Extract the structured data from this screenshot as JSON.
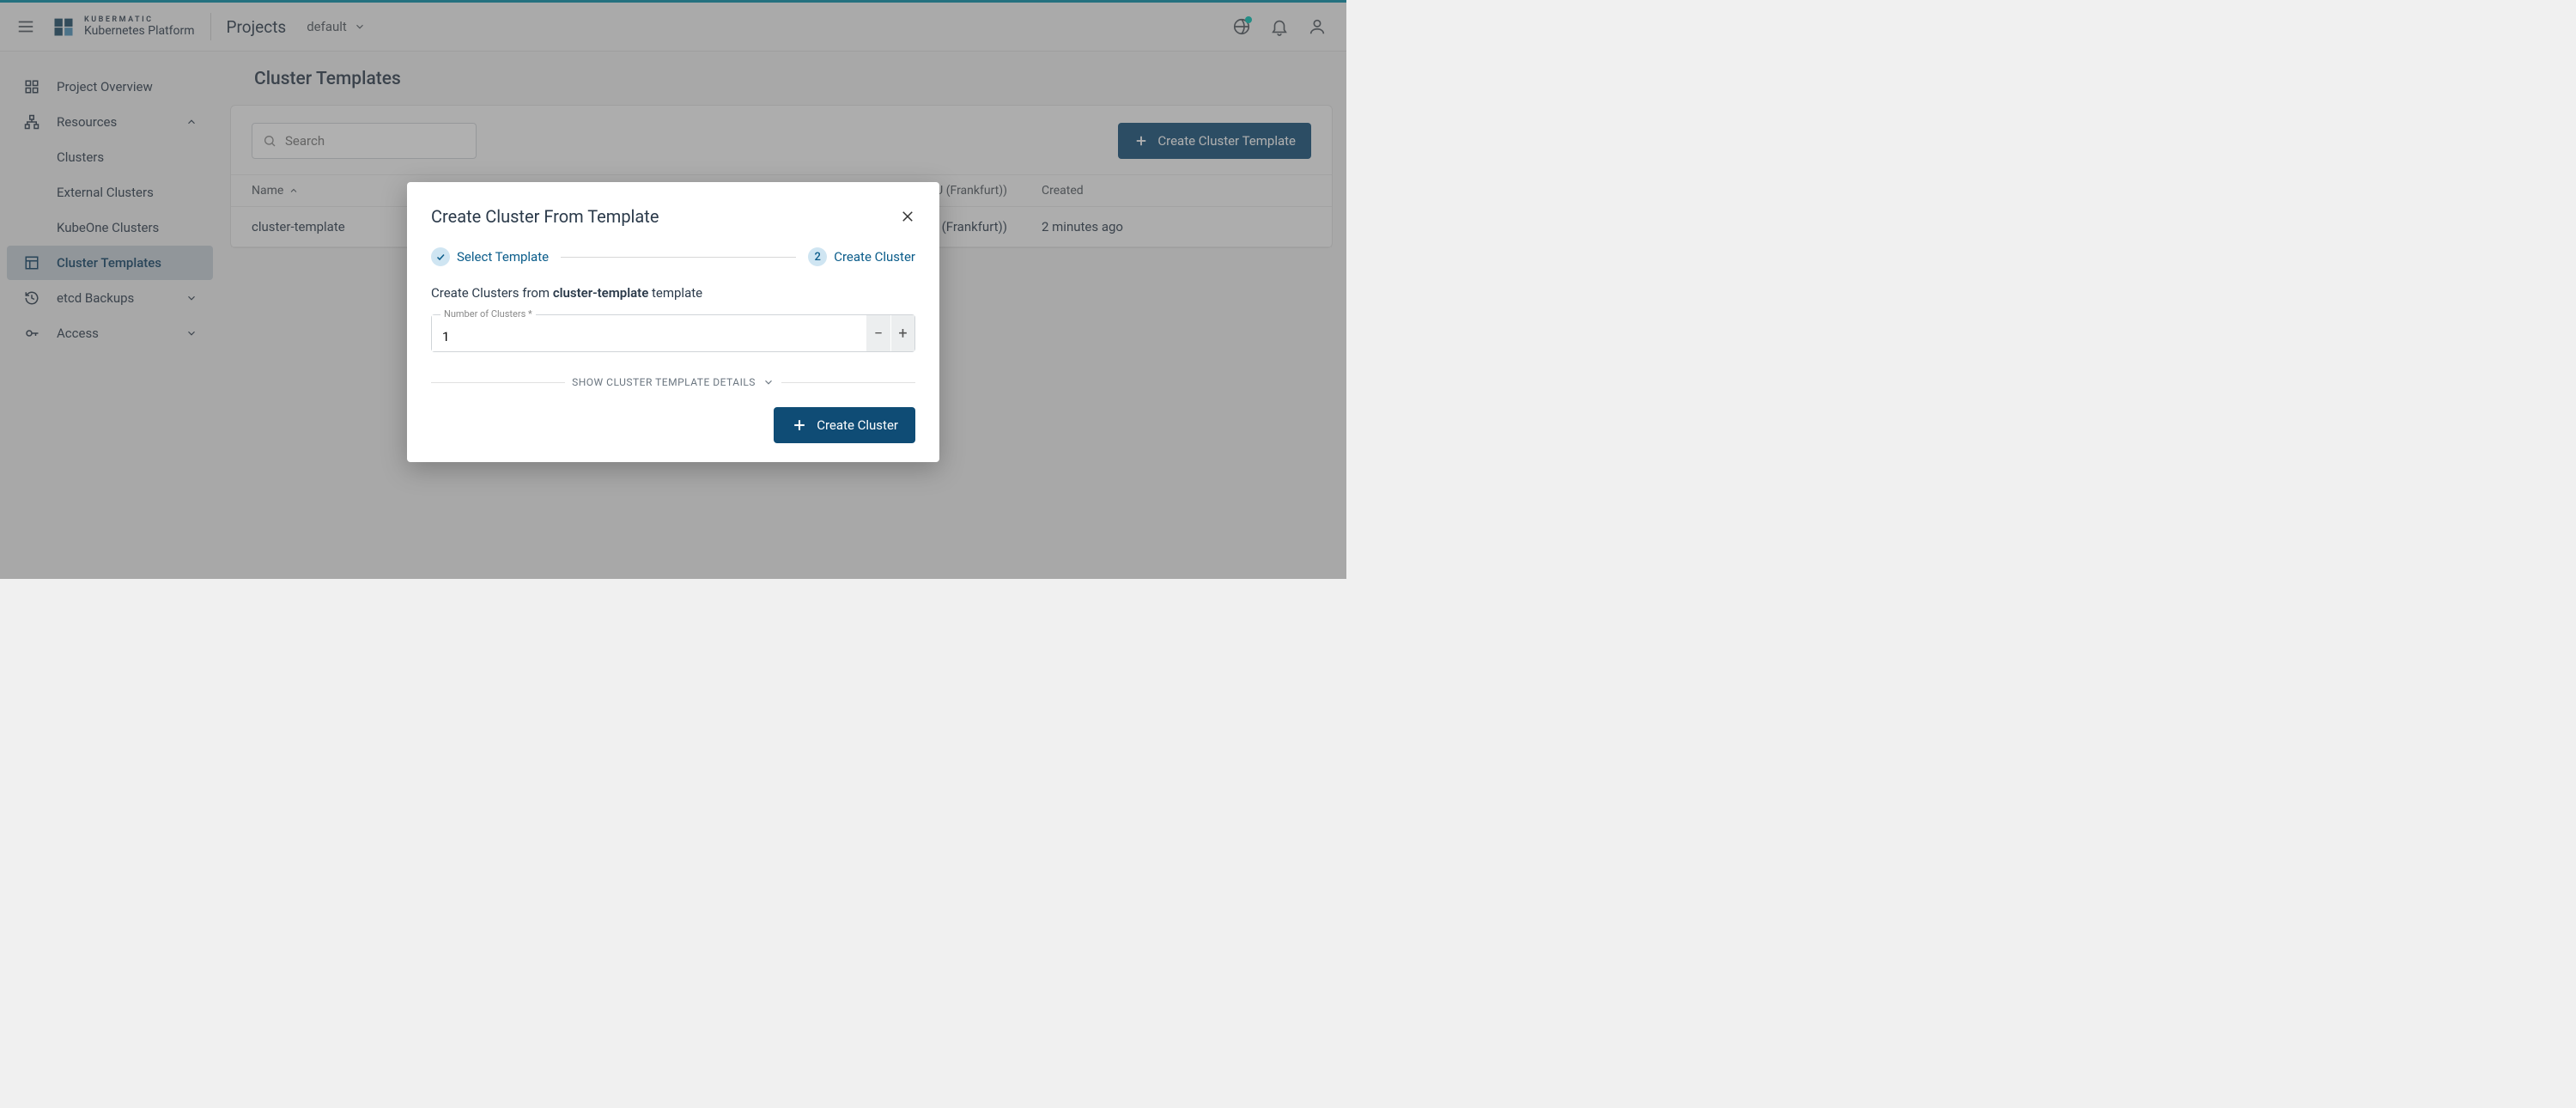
{
  "header": {
    "brand_top": "KUBERMATIC",
    "brand_bottom": "Kubernetes Platform",
    "projects_label": "Projects",
    "project_selected": "default"
  },
  "sidebar": {
    "items": [
      {
        "label": "Project Overview"
      },
      {
        "label": "Resources"
      },
      {
        "label": "Clusters"
      },
      {
        "label": "External Clusters"
      },
      {
        "label": "KubeOne Clusters"
      },
      {
        "label": "Cluster Templates"
      },
      {
        "label": "etcd Backups"
      },
      {
        "label": "Access"
      }
    ]
  },
  "page": {
    "title": "Cluster Templates",
    "search_placeholder": "Search",
    "create_button": "Create Cluster Template",
    "table": {
      "columns": {
        "name": "Name",
        "provider": "U (Frankfurt))",
        "created": "Created"
      },
      "rows": [
        {
          "name": "cluster-template",
          "provider": "U (Frankfurt))",
          "created": "2 minutes ago"
        }
      ]
    }
  },
  "modal": {
    "title": "Create Cluster From Template",
    "step1": "Select Template",
    "step2_num": "2",
    "step2": "Create Cluster",
    "subtext_prefix": "Create Clusters from ",
    "subtext_template": "cluster-template",
    "subtext_suffix": " template",
    "num_label": "Number of Clusters *",
    "num_value": "1",
    "details_toggle": "SHOW CLUSTER TEMPLATE DETAILS",
    "action": "Create Cluster"
  }
}
